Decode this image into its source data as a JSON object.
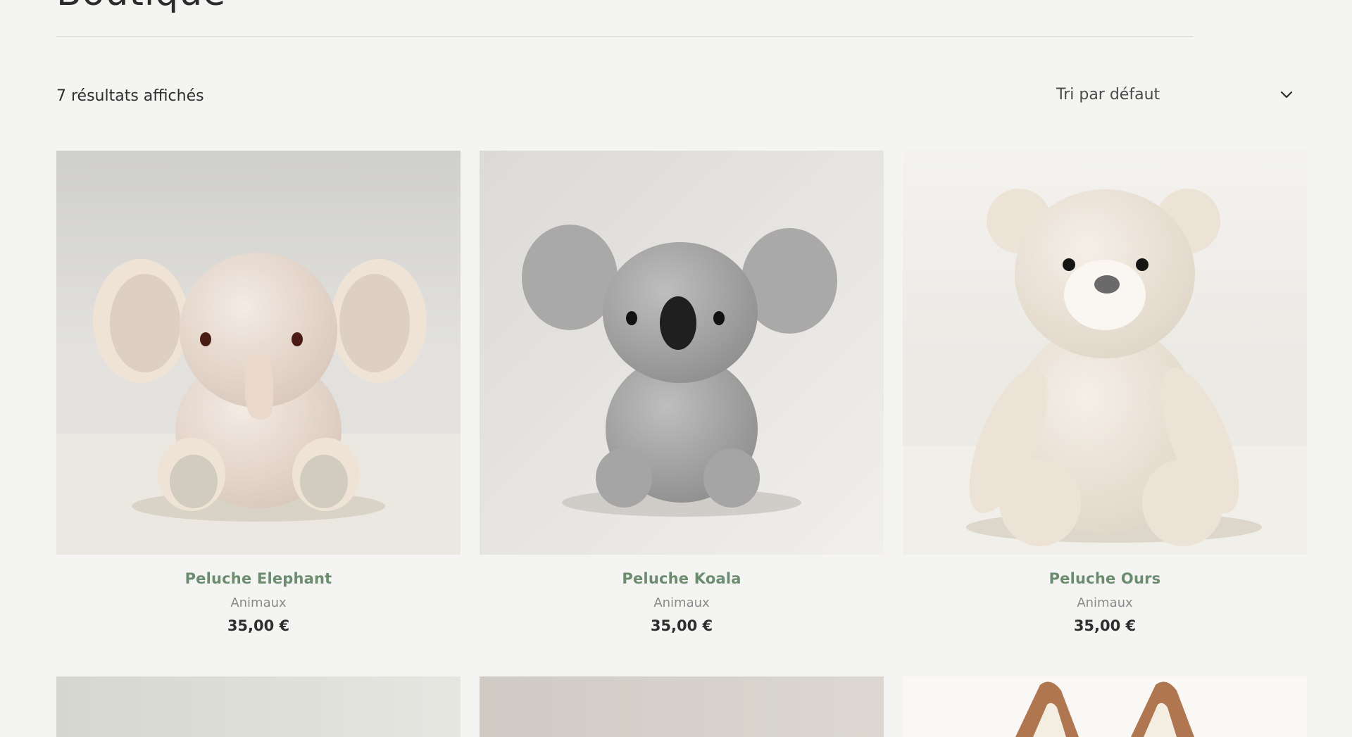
{
  "page": {
    "title": "Boutique"
  },
  "toolbar": {
    "results_text": "7 résultats affichés",
    "sort_label": "Tri par défaut",
    "sort_icon": "chevron-down-icon"
  },
  "products": [
    {
      "name": "Peluche Elephant",
      "category": "Animaux",
      "price": "35,00 €",
      "image": "elephant-plush"
    },
    {
      "name": "Peluche Koala",
      "category": "Animaux",
      "price": "35,00 €",
      "image": "koala-plush"
    },
    {
      "name": "Peluche Ours",
      "category": "Animaux",
      "price": "35,00 €",
      "image": "bear-plush"
    }
  ],
  "colors": {
    "background": "#f4f5f2",
    "product_name": "#6b8c6e",
    "price": "#2e2e2e"
  }
}
